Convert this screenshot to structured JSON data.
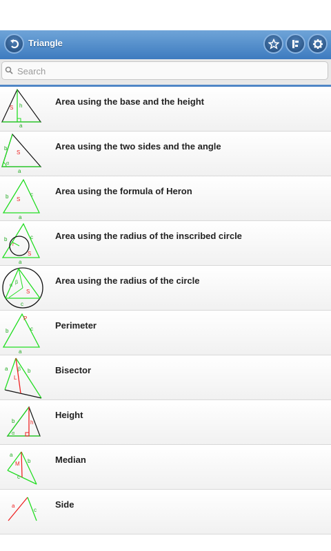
{
  "header": {
    "title": "Triangle"
  },
  "search": {
    "placeholder": "Search"
  },
  "items": [
    {
      "label": "Area using the base and the height"
    },
    {
      "label": "Area using the two sides and the angle"
    },
    {
      "label": "Area using the formula of Heron"
    },
    {
      "label": "Area using the radius of the inscribed circle"
    },
    {
      "label": "Area using the radius of the circle"
    },
    {
      "label": "Perimeter"
    },
    {
      "label": "Bisector"
    },
    {
      "label": "Height"
    },
    {
      "label": "Median"
    },
    {
      "label": "Side"
    }
  ],
  "thumb_text": {
    "s": "S",
    "h": "h",
    "a": "a",
    "b": "b",
    "c": "c",
    "p": "P",
    "l": "L",
    "m": "M",
    "alpha": "α",
    "beta": "β",
    "r": "r"
  },
  "colors": {
    "accent": "#3d7bbf",
    "shape_green": "#22dd22",
    "shape_red": "#ee2222"
  }
}
